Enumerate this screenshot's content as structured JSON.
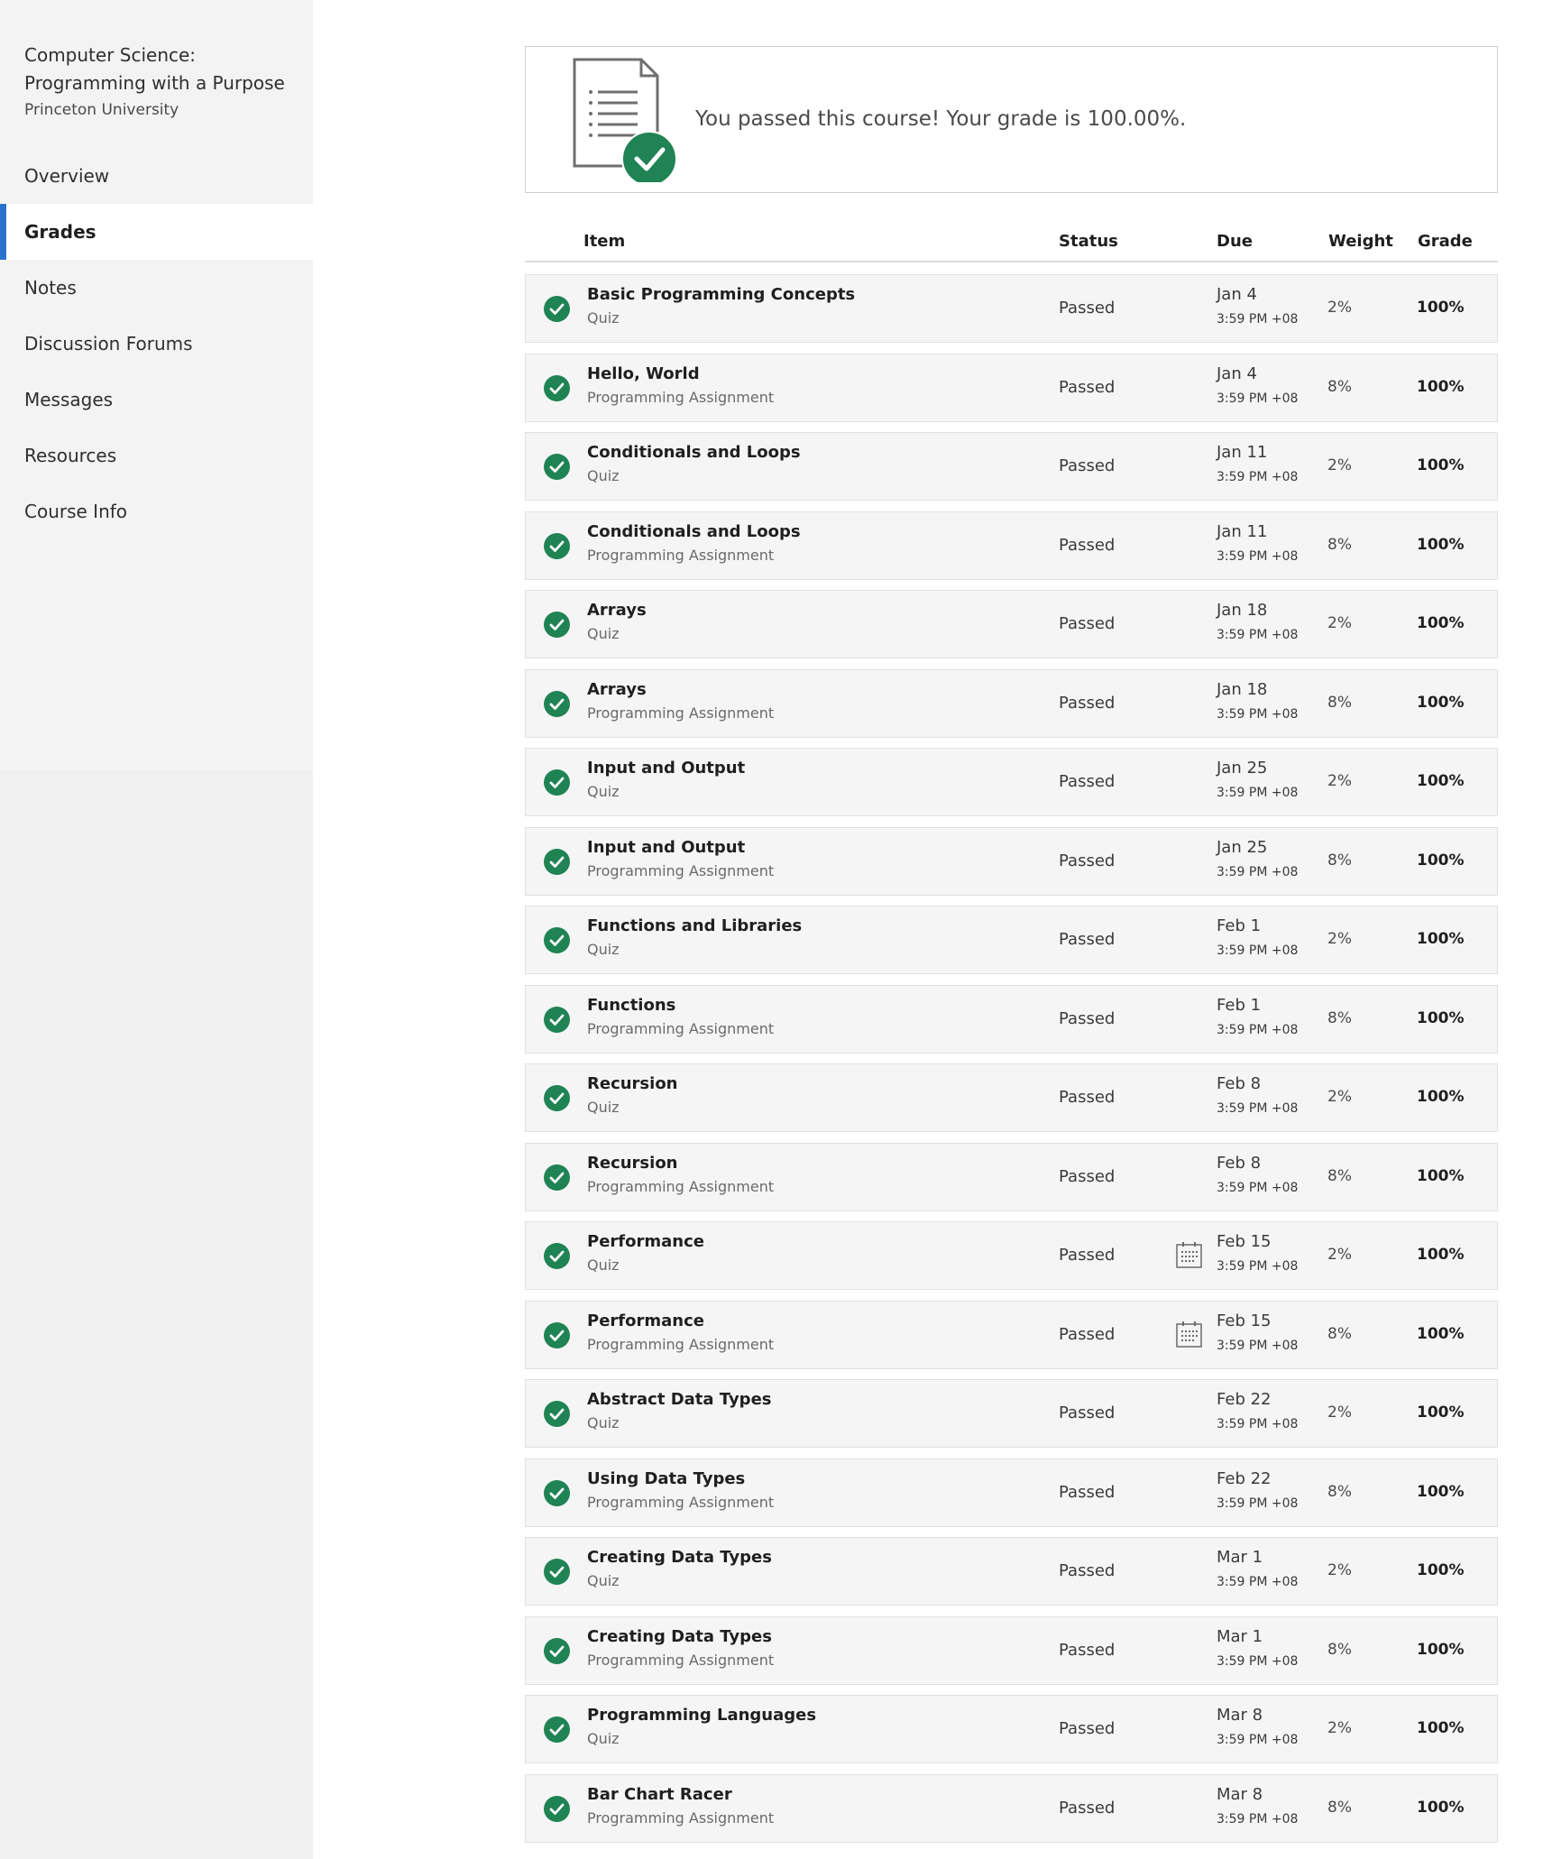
{
  "sidebar": {
    "course_title": "Computer Science: Programming with a Purpose",
    "university": "Princeton University",
    "items": [
      {
        "label": "Overview",
        "active": false
      },
      {
        "label": "Grades",
        "active": true
      },
      {
        "label": "Notes",
        "active": false
      },
      {
        "label": "Discussion Forums",
        "active": false
      },
      {
        "label": "Messages",
        "active": false
      },
      {
        "label": "Resources",
        "active": false
      },
      {
        "label": "Course Info",
        "active": false
      }
    ]
  },
  "banner": {
    "message": "You passed this course! Your grade is 100.00%.",
    "icon": "document-check-icon"
  },
  "table": {
    "headers": {
      "item": "Item",
      "status": "Status",
      "due": "Due",
      "weight": "Weight",
      "grade": "Grade"
    },
    "rows": [
      {
        "name": "Basic Programming Concepts",
        "type": "Quiz",
        "status": "Passed",
        "due_date": "Jan 4",
        "due_time": "3:59 PM +08",
        "weight": "2%",
        "grade": "100%",
        "calendar": false
      },
      {
        "name": "Hello, World",
        "type": "Programming Assignment",
        "status": "Passed",
        "due_date": "Jan 4",
        "due_time": "3:59 PM +08",
        "weight": "8%",
        "grade": "100%",
        "calendar": false
      },
      {
        "name": "Conditionals and Loops",
        "type": "Quiz",
        "status": "Passed",
        "due_date": "Jan 11",
        "due_time": "3:59 PM +08",
        "weight": "2%",
        "grade": "100%",
        "calendar": false
      },
      {
        "name": "Conditionals and Loops",
        "type": "Programming Assignment",
        "status": "Passed",
        "due_date": "Jan 11",
        "due_time": "3:59 PM +08",
        "weight": "8%",
        "grade": "100%",
        "calendar": false
      },
      {
        "name": "Arrays",
        "type": "Quiz",
        "status": "Passed",
        "due_date": "Jan 18",
        "due_time": "3:59 PM +08",
        "weight": "2%",
        "grade": "100%",
        "calendar": false
      },
      {
        "name": "Arrays",
        "type": "Programming Assignment",
        "status": "Passed",
        "due_date": "Jan 18",
        "due_time": "3:59 PM +08",
        "weight": "8%",
        "grade": "100%",
        "calendar": false
      },
      {
        "name": "Input and Output",
        "type": "Quiz",
        "status": "Passed",
        "due_date": "Jan 25",
        "due_time": "3:59 PM +08",
        "weight": "2%",
        "grade": "100%",
        "calendar": false
      },
      {
        "name": "Input and Output",
        "type": "Programming Assignment",
        "status": "Passed",
        "due_date": "Jan 25",
        "due_time": "3:59 PM +08",
        "weight": "8%",
        "grade": "100%",
        "calendar": false
      },
      {
        "name": "Functions and Libraries",
        "type": "Quiz",
        "status": "Passed",
        "due_date": "Feb 1",
        "due_time": "3:59 PM +08",
        "weight": "2%",
        "grade": "100%",
        "calendar": false
      },
      {
        "name": "Functions",
        "type": "Programming Assignment",
        "status": "Passed",
        "due_date": "Feb 1",
        "due_time": "3:59 PM +08",
        "weight": "8%",
        "grade": "100%",
        "calendar": false
      },
      {
        "name": "Recursion",
        "type": "Quiz",
        "status": "Passed",
        "due_date": "Feb 8",
        "due_time": "3:59 PM +08",
        "weight": "2%",
        "grade": "100%",
        "calendar": false
      },
      {
        "name": "Recursion",
        "type": "Programming Assignment",
        "status": "Passed",
        "due_date": "Feb 8",
        "due_time": "3:59 PM +08",
        "weight": "8%",
        "grade": "100%",
        "calendar": false
      },
      {
        "name": "Performance",
        "type": "Quiz",
        "status": "Passed",
        "due_date": "Feb 15",
        "due_time": "3:59 PM +08",
        "weight": "2%",
        "grade": "100%",
        "calendar": true
      },
      {
        "name": "Performance",
        "type": "Programming Assignment",
        "status": "Passed",
        "due_date": "Feb 15",
        "due_time": "3:59 PM +08",
        "weight": "8%",
        "grade": "100%",
        "calendar": true
      },
      {
        "name": "Abstract Data Types",
        "type": "Quiz",
        "status": "Passed",
        "due_date": "Feb 22",
        "due_time": "3:59 PM +08",
        "weight": "2%",
        "grade": "100%",
        "calendar": false
      },
      {
        "name": "Using Data Types",
        "type": "Programming Assignment",
        "status": "Passed",
        "due_date": "Feb 22",
        "due_time": "3:59 PM +08",
        "weight": "8%",
        "grade": "100%",
        "calendar": false
      },
      {
        "name": "Creating Data Types",
        "type": "Quiz",
        "status": "Passed",
        "due_date": "Mar 1",
        "due_time": "3:59 PM +08",
        "weight": "2%",
        "grade": "100%",
        "calendar": false
      },
      {
        "name": "Creating Data Types",
        "type": "Programming Assignment",
        "status": "Passed",
        "due_date": "Mar 1",
        "due_time": "3:59 PM +08",
        "weight": "8%",
        "grade": "100%",
        "calendar": false
      },
      {
        "name": "Programming Languages",
        "type": "Quiz",
        "status": "Passed",
        "due_date": "Mar 8",
        "due_time": "3:59 PM +08",
        "weight": "2%",
        "grade": "100%",
        "calendar": false
      },
      {
        "name": "Bar Chart Racer",
        "type": "Programming Assignment",
        "status": "Passed",
        "due_date": "Mar 8",
        "due_time": "3:59 PM +08",
        "weight": "8%",
        "grade": "100%",
        "calendar": false
      }
    ]
  },
  "colors": {
    "accent": "#2a73cc",
    "success": "#1f8354",
    "sidebar_bg": "#f3f3f3"
  }
}
